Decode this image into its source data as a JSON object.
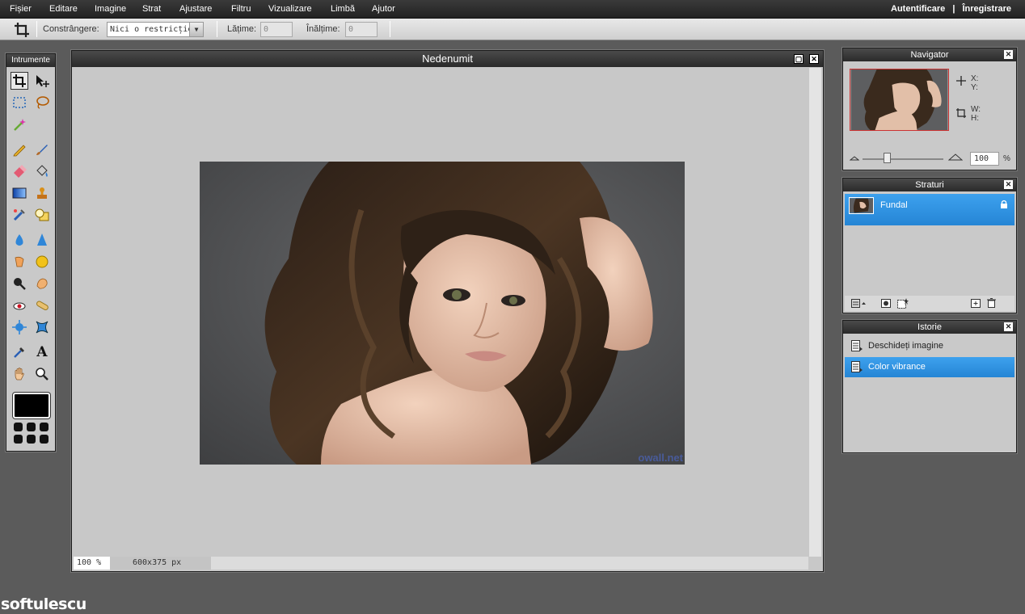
{
  "menu": {
    "items": [
      "Fișier",
      "Editare",
      "Imagine",
      "Strat",
      "Ajustare",
      "Filtru",
      "Vizualizare",
      "Limbă",
      "Ajutor"
    ],
    "login": "Autentificare",
    "separator": "|",
    "register": "Înregistrare"
  },
  "options": {
    "constraint_label": "Constrângere:",
    "constraint_value": "Nici o restricție",
    "width_label": "Lățime:",
    "width_value": "0",
    "height_label": "Înălțime:",
    "height_value": "0"
  },
  "tools": {
    "title": "Intrumente",
    "foreground_color": "#000000"
  },
  "document": {
    "title": "Nedenumit",
    "zoom": "100 %",
    "size": "600x375 px",
    "watermark": "owall.net"
  },
  "navigator": {
    "title": "Navigator",
    "x_label": "X:",
    "y_label": "Y:",
    "w_label": "W:",
    "h_label": "H:",
    "zoom_value": "100",
    "zoom_unit": "%",
    "zoom_fraction": 0.3
  },
  "layers": {
    "title": "Straturi",
    "items": [
      {
        "name": "Fundal"
      }
    ]
  },
  "history": {
    "title": "Istorie",
    "items": [
      {
        "label": "Deschideți imagine",
        "selected": false
      },
      {
        "label": "Color vibrance",
        "selected": true
      }
    ]
  },
  "brand": "softulescu",
  "colors": {
    "accent": "#2f95e4",
    "menubar": "#2a2a2a",
    "workspace": "#5b5b5b"
  }
}
